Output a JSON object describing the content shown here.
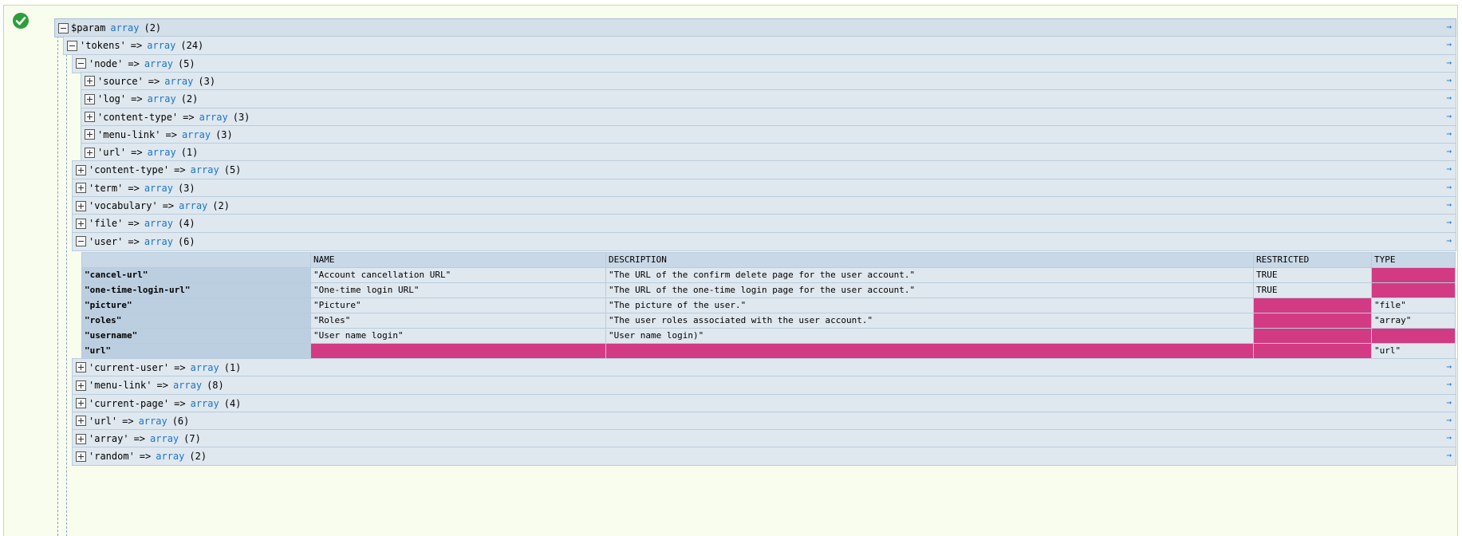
{
  "status": {
    "icon": "check-circle-icon",
    "color": "#2e9e3b"
  },
  "colors": {
    "type_link": "#1b74c9",
    "missing_cell": "#d23a84",
    "panel_bg": "#f8fdee"
  },
  "rows": [
    {
      "key": "$param",
      "type": "array",
      "count": "(2)",
      "expanded": true
    },
    {
      "key": "'tokens'",
      "type": "array",
      "count": "(24)",
      "expanded": true
    },
    {
      "key": "'node'",
      "type": "array",
      "count": "(5)",
      "expanded": true
    },
    {
      "key": "'source'",
      "type": "array",
      "count": "(3)",
      "expanded": false
    },
    {
      "key": "'log'",
      "type": "array",
      "count": "(2)",
      "expanded": false
    },
    {
      "key": "'content-type'",
      "type": "array",
      "count": "(3)",
      "expanded": false
    },
    {
      "key": "'menu-link'",
      "type": "array",
      "count": "(3)",
      "expanded": false
    },
    {
      "key": "'url'",
      "type": "array",
      "count": "(1)",
      "expanded": false
    },
    {
      "key": "'content-type'",
      "type": "array",
      "count": "(5)",
      "expanded": false
    },
    {
      "key": "'term'",
      "type": "array",
      "count": "(3)",
      "expanded": false
    },
    {
      "key": "'vocabulary'",
      "type": "array",
      "count": "(2)",
      "expanded": false
    },
    {
      "key": "'file'",
      "type": "array",
      "count": "(4)",
      "expanded": false
    },
    {
      "key": "'user'",
      "type": "array",
      "count": "(6)",
      "expanded": true
    },
    {
      "key": "'current-user'",
      "type": "array",
      "count": "(1)",
      "expanded": false
    },
    {
      "key": "'menu-link'",
      "type": "array",
      "count": "(8)",
      "expanded": false
    },
    {
      "key": "'current-page'",
      "type": "array",
      "count": "(4)",
      "expanded": false
    },
    {
      "key": "'url'",
      "type": "array",
      "count": "(6)",
      "expanded": false
    },
    {
      "key": "'array'",
      "type": "array",
      "count": "(7)",
      "expanded": false
    },
    {
      "key": "'random'",
      "type": "array",
      "count": "(2)",
      "expanded": false
    }
  ],
  "arrow_text": "=>",
  "jump_glyph": "→",
  "user_table": {
    "headers": [
      "",
      "NAME",
      "DESCRIPTION",
      "RESTRICTED",
      "TYPE"
    ],
    "rows": [
      [
        "\"cancel-url\"",
        "\"Account cancellation URL\"",
        "\"The URL of the confirm delete page for the user account.\"",
        "TRUE",
        null
      ],
      [
        "\"one-time-login-url\"",
        "\"One-time login URL\"",
        "\"The URL of the one-time login page for the user account.\"",
        "TRUE",
        null
      ],
      [
        "\"picture\"",
        "\"Picture\"",
        "\"The picture of the user.\"",
        null,
        "\"file\""
      ],
      [
        "\"roles\"",
        "\"Roles\"",
        "\"The user roles associated with the user account.\"",
        null,
        "\"array\""
      ],
      [
        "\"username\"",
        "\"User name login\"",
        "\"User name login)\"",
        null,
        null
      ],
      [
        "\"url\"",
        null,
        null,
        null,
        "\"url\""
      ]
    ]
  }
}
